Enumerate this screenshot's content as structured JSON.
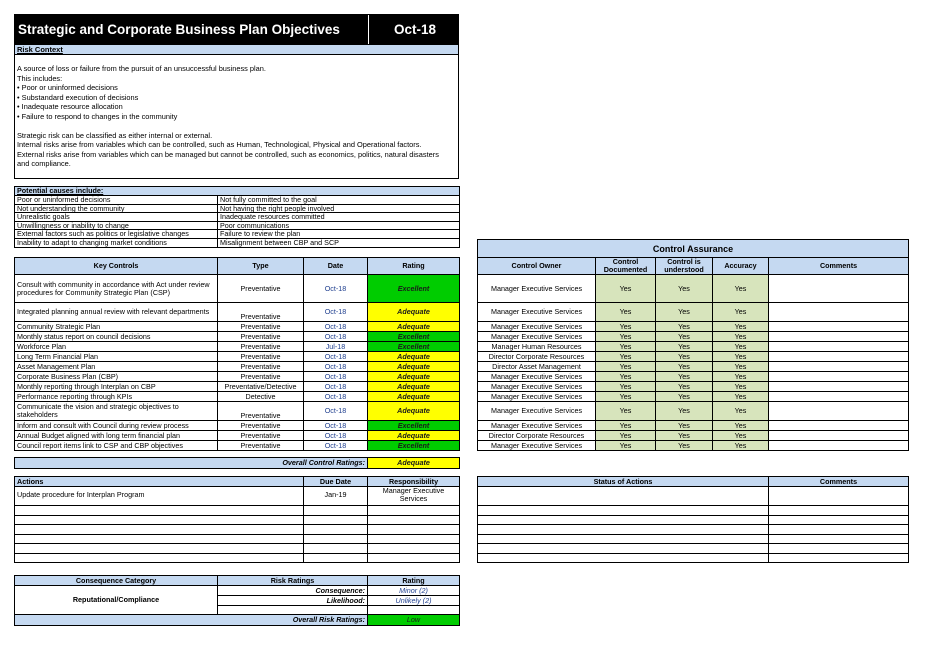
{
  "header": {
    "title": "Strategic and Corporate Business Plan Objectives",
    "date": "Oct-18"
  },
  "risk_context": {
    "heading": "Risk Context",
    "lines": [
      "A source of loss or failure from the pursuit of an unsuccessful business plan.",
      "This includes:",
      "• Poor or uninformed decisions",
      "• Substandard execution of decisions",
      "• Inadequate resource allocation",
      "• Failure to respond to changes in the community",
      "",
      "Strategic risk can be classified as either internal or external.",
      "Internal risks arise from variables which can be controlled, such as Human, Technological, Physical and Operational factors.",
      "External risks arise from variables which can be managed but cannot be controlled, such as economics, politics, natural disasters",
      "and compliance."
    ]
  },
  "causes": {
    "heading": "Potential causes include:",
    "rows": [
      [
        "Poor or uninformed decisions",
        "Not fully committed to the goal"
      ],
      [
        "Not understanding the community",
        "Not having the right people involved"
      ],
      [
        "Unrealistic goals",
        "Inadequate resources committed"
      ],
      [
        "Unwillingness or inability to change",
        "Poor communications"
      ],
      [
        "External factors such as politics or legislative changes",
        "Failure to review the plan"
      ],
      [
        "Inability to adapt to changing market conditions",
        "Misalignment between CBP and SCP"
      ]
    ]
  },
  "controls": {
    "headers": {
      "key": "Key Controls",
      "type": "Type",
      "date": "Date",
      "rating": "Rating"
    },
    "rows": [
      {
        "name": "Consult with community in accordance with Act under review procedures for Community Strategic Plan (CSP)",
        "type": "Preventative",
        "date": "Oct-18",
        "rating": "Excellent"
      },
      {
        "name": "Integrated planning annual review with relevant departments",
        "type": "Preventative",
        "date": "Oct-18",
        "rating": "Adequate"
      },
      {
        "name": "Community Strategic Plan",
        "type": "Preventative",
        "date": "Oct-18",
        "rating": "Adequate"
      },
      {
        "name": "Monthly status report on council decisions",
        "type": "Preventative",
        "date": "Oct-18",
        "rating": "Excellent"
      },
      {
        "name": "Workforce Plan",
        "type": "Preventative",
        "date": "Jul-18",
        "rating": "Excellent"
      },
      {
        "name": "Long Term Financial Plan",
        "type": "Preventative",
        "date": "Oct-18",
        "rating": "Adequate"
      },
      {
        "name": "Asset Management Plan",
        "type": "Preventative",
        "date": "Oct-18",
        "rating": "Adequate"
      },
      {
        "name": "Corporate Business Plan (CBP)",
        "type": "Preventative",
        "date": "Oct-18",
        "rating": "Adequate"
      },
      {
        "name": "Monthly reporting through Interplan on CBP",
        "type": "Preventative/Detective",
        "date": "Oct-18",
        "rating": "Adequate"
      },
      {
        "name": "Performance reporting through KPIs",
        "type": "Detective",
        "date": "Oct-18",
        "rating": "Adequate"
      },
      {
        "name": "Communicate the vision and strategic objectives to stakeholders",
        "type": "Preventative",
        "date": "Oct-18",
        "rating": "Adequate"
      },
      {
        "name": "Inform and consult with Council during review process",
        "type": "Preventative",
        "date": "Oct-18",
        "rating": "Excellent"
      },
      {
        "name": "Annual Budget aligned with long term financial plan",
        "type": "Preventative",
        "date": "Oct-18",
        "rating": "Adequate"
      },
      {
        "name": "Council report items link to CSP and CBP objectives",
        "type": "Preventative",
        "date": "Oct-18",
        "rating": "Excellent"
      }
    ],
    "overall_label": "Overall Control Ratings:",
    "overall_value": "Adequate"
  },
  "assurance": {
    "title": "Control Assurance",
    "headers": {
      "owner": "Control Owner",
      "documented": "Control Documented",
      "understood": "Control is understood",
      "accuracy": "Accuracy",
      "comments": "Comments"
    },
    "rows": [
      {
        "owner": "Manager Executive Services",
        "doc": "Yes",
        "und": "Yes",
        "acc": "Yes"
      },
      {
        "owner": "Manager Executive Services",
        "doc": "Yes",
        "und": "Yes",
        "acc": "Yes"
      },
      {
        "owner": "Manager Executive Services",
        "doc": "Yes",
        "und": "Yes",
        "acc": "Yes"
      },
      {
        "owner": "Manager Executive Services",
        "doc": "Yes",
        "und": "Yes",
        "acc": "Yes"
      },
      {
        "owner": "Manager Human Resources",
        "doc": "Yes",
        "und": "Yes",
        "acc": "Yes"
      },
      {
        "owner": "Director Corporate Resources",
        "doc": "Yes",
        "und": "Yes",
        "acc": "Yes"
      },
      {
        "owner": "Director Asset Management",
        "doc": "Yes",
        "und": "Yes",
        "acc": "Yes"
      },
      {
        "owner": "Manager Executive Services",
        "doc": "Yes",
        "und": "Yes",
        "acc": "Yes"
      },
      {
        "owner": "Manager Executive Services",
        "doc": "Yes",
        "und": "Yes",
        "acc": "Yes"
      },
      {
        "owner": "Manager Executive Services",
        "doc": "Yes",
        "und": "Yes",
        "acc": "Yes"
      },
      {
        "owner": "Manager Executive Services",
        "doc": "Yes",
        "und": "Yes",
        "acc": "Yes"
      },
      {
        "owner": "Manager Executive Services",
        "doc": "Yes",
        "und": "Yes",
        "acc": "Yes"
      },
      {
        "owner": "Director Corporate Resources",
        "doc": "Yes",
        "und": "Yes",
        "acc": "Yes"
      },
      {
        "owner": "Manager Executive Services",
        "doc": "Yes",
        "und": "Yes",
        "acc": "Yes"
      }
    ]
  },
  "actions": {
    "headers": {
      "actions": "Actions",
      "due": "Due Date",
      "resp": "Responsibility"
    },
    "rows": [
      {
        "action": "Update procedure for Interplan Program",
        "due": "Jan-19",
        "resp": "Manager Executive Services"
      }
    ]
  },
  "status": {
    "headers": {
      "status": "Status of Actions",
      "comments": "Comments"
    }
  },
  "consequence": {
    "headers": {
      "category": "Consequence Category",
      "ratings": "Risk Ratings",
      "rating": "Rating"
    },
    "category": "Reputational/Compliance",
    "consequence_label": "Consequence:",
    "consequence_value": "Minor (2)",
    "likelihood_label": "Likelihood:",
    "likelihood_value": "Unlikely (2)",
    "overall_label": "Overall Risk Ratings:",
    "overall_value": "Low"
  },
  "colors": {
    "header_blue": "#c5d9f1",
    "excellent": "#00cc00",
    "adequate": "#ffff00",
    "yes_green": "#d7e4bc"
  }
}
